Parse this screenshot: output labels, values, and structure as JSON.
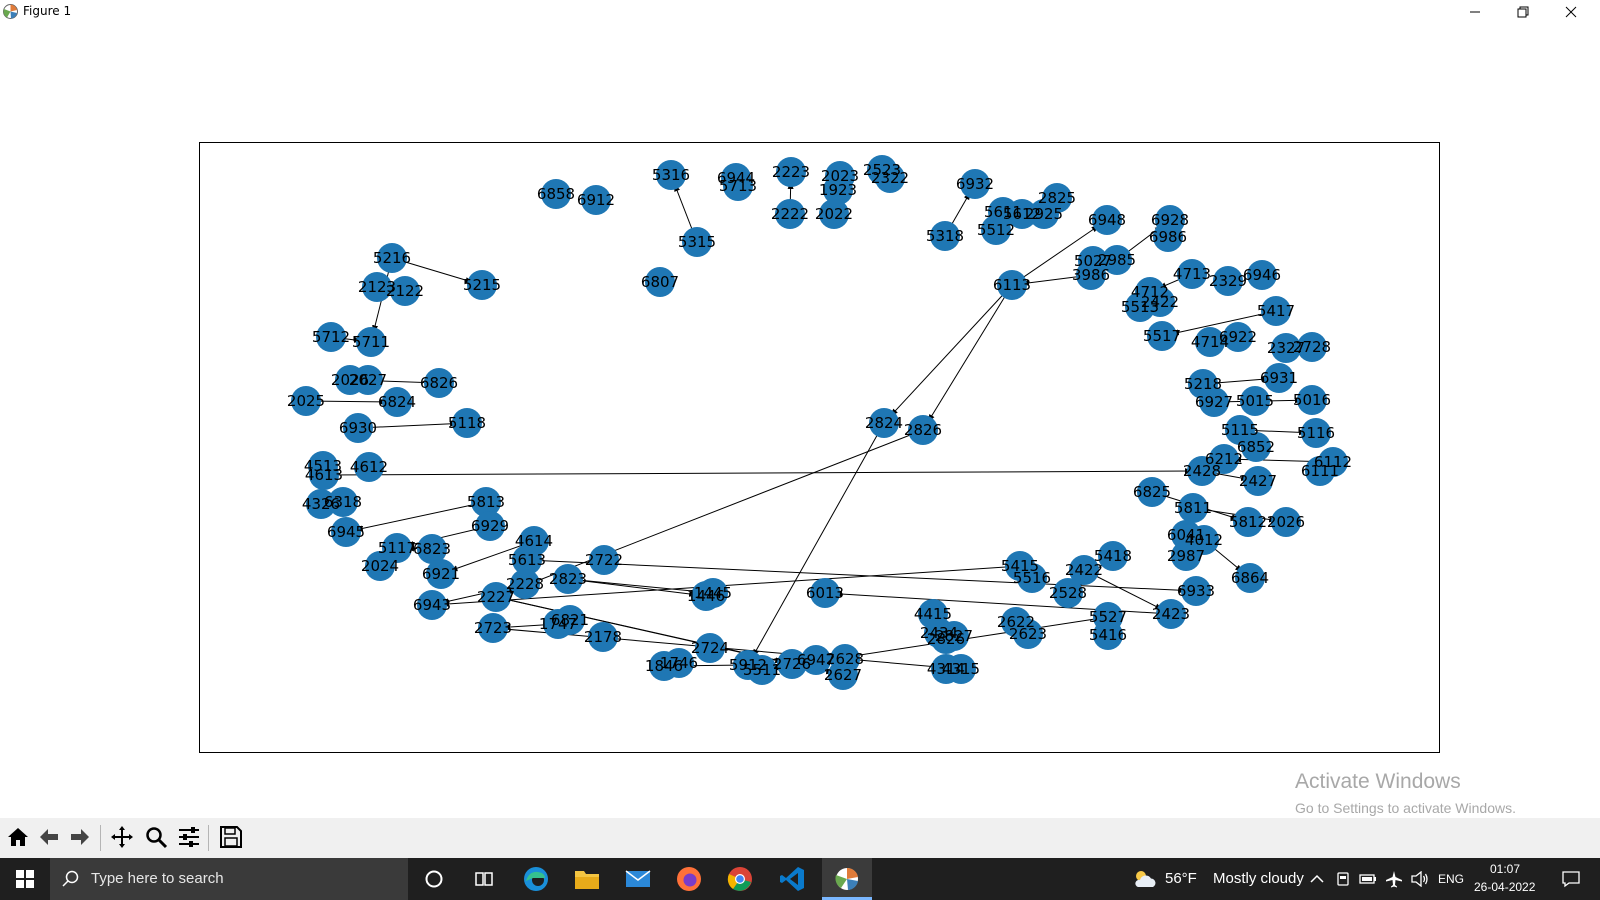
{
  "window": {
    "title": "Figure 1",
    "controls": [
      "minimize",
      "restore",
      "close"
    ]
  },
  "graph": {
    "nodes": [
      "5316",
      "6944",
      "5713",
      "2223",
      "2023",
      "1923",
      "2523",
      "2322",
      "6858",
      "6912",
      "6932",
      "2825",
      "5315",
      "2222",
      "2022",
      "6807",
      "5318",
      "5611",
      "5612",
      "2925",
      "5512",
      "6948",
      "6928",
      "6986",
      "5216",
      "5215",
      "2123",
      "2122",
      "6113",
      "5027",
      "2985",
      "3986",
      "4713",
      "4712",
      "2329",
      "6946",
      "5513",
      "2422",
      "5417",
      "5712",
      "5711",
      "5517",
      "4714",
      "6922",
      "2327",
      "2728",
      "2026",
      "2027",
      "6826",
      "5218",
      "6931",
      "2025",
      "6824",
      "6927",
      "5015",
      "5016",
      "5118",
      "6930",
      "2824",
      "2826",
      "5115",
      "5116",
      "6852",
      "6212",
      "4513",
      "4612",
      "4613",
      "2428",
      "2427",
      "6112",
      "6111",
      "4326",
      "6318",
      "5813",
      "6825",
      "5811",
      "5812",
      "2026",
      "6929",
      "6945",
      "4614",
      "6041",
      "4012",
      "5117",
      "6823",
      "2024",
      "5613",
      "2722",
      "2987",
      "6864",
      "2823",
      "6921",
      "2228",
      "5415",
      "5418",
      "5516",
      "2422",
      "6933",
      "2227",
      "6943",
      "6013",
      "2528",
      "2423",
      "1446",
      "1445",
      "2723",
      "1747",
      "6821",
      "2178",
      "4415",
      "2622",
      "2623",
      "5527",
      "5416",
      "2724",
      "5912",
      "5511",
      "2726",
      "6947",
      "2628",
      "2627",
      "1846",
      "1746",
      "2434",
      "4314",
      "4315",
      "2826",
      "2827"
    ],
    "edge_style": {
      "color": "#000000",
      "arrows": true
    },
    "node_color": "#1f77b4"
  },
  "watermark": {
    "line1": "Activate Windows",
    "line2": "Go to Settings to activate Windows."
  },
  "toolbar": {
    "buttons": [
      "home-icon",
      "back-arrow-icon",
      "forward-arrow-icon",
      "pan-icon",
      "zoom-icon",
      "configure-subplots-icon",
      "save-icon"
    ]
  },
  "taskbar": {
    "search_placeholder": "Type here to search",
    "weather_temp": "56°F",
    "weather_desc": "Mostly cloudy",
    "language": "ENG",
    "time": "01:07",
    "date": "26-04-2022"
  }
}
